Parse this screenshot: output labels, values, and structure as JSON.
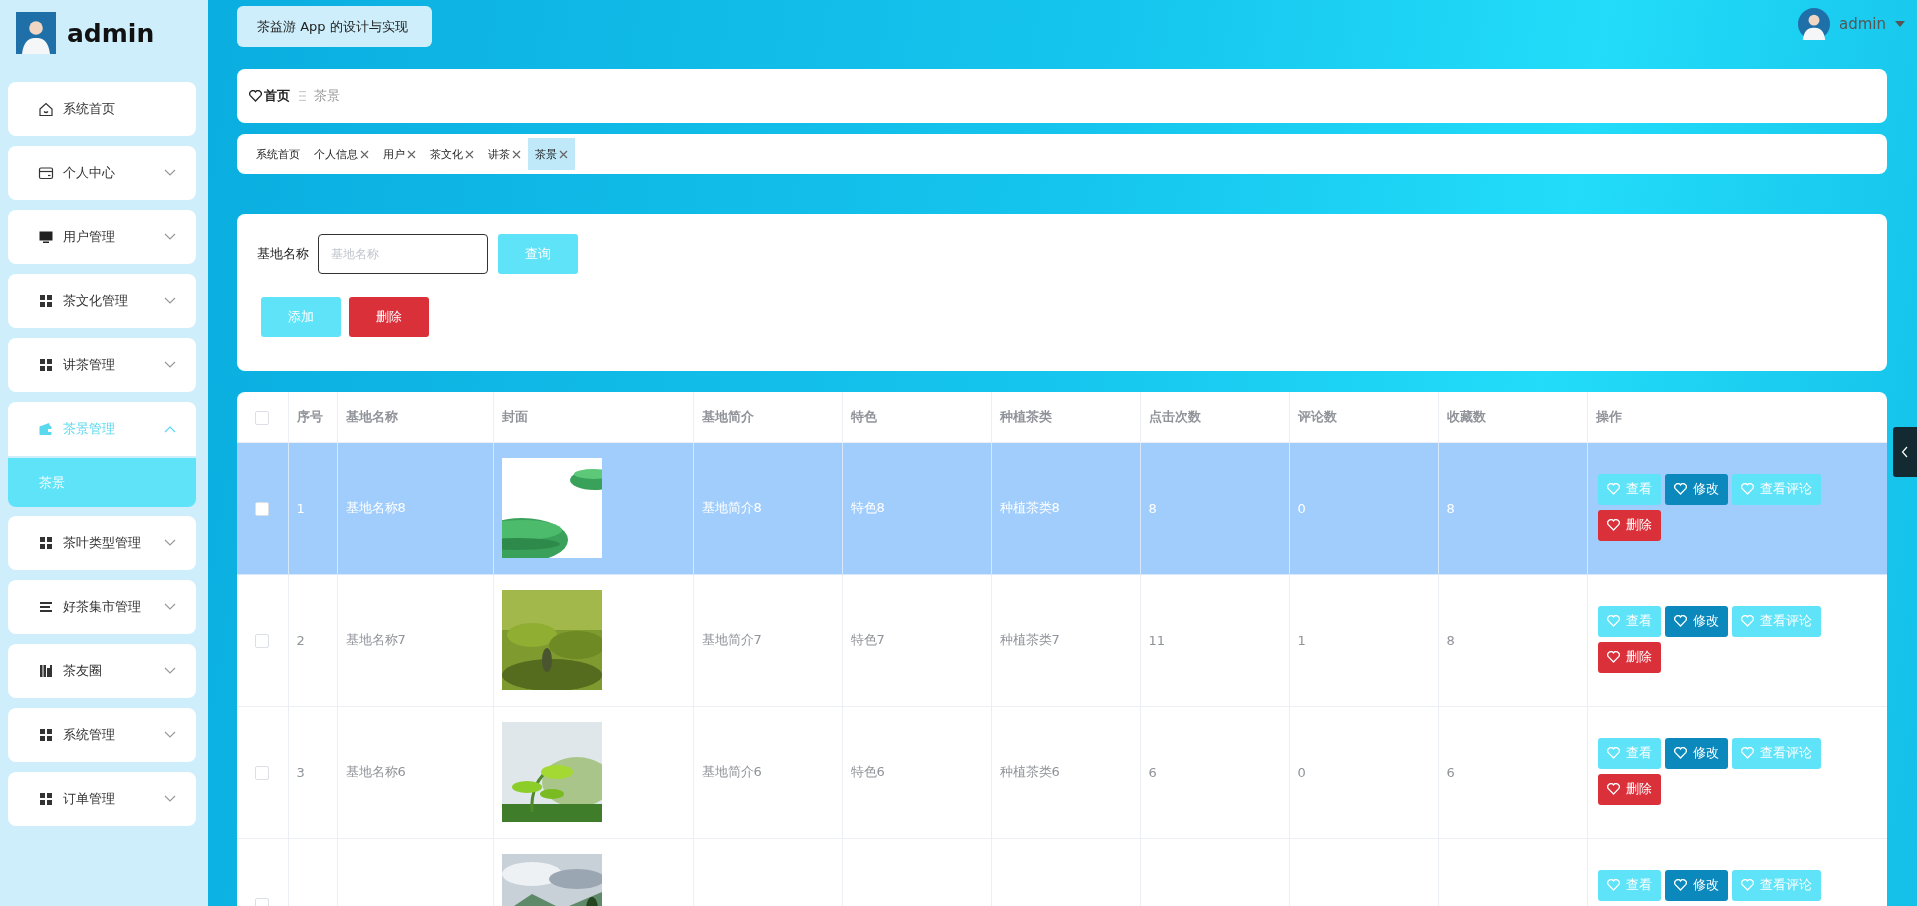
{
  "app_title": "茶益游 App 的设计与实现",
  "sidebar": {
    "user_name": "admin",
    "items": [
      {
        "label": "系统首页",
        "kind": "link",
        "selected": false
      },
      {
        "label": "个人中心",
        "kind": "group",
        "expanded": false,
        "selected": false
      },
      {
        "label": "用户管理",
        "kind": "group",
        "expanded": false,
        "selected": false
      },
      {
        "label": "茶文化管理",
        "kind": "group",
        "expanded": false,
        "selected": false
      },
      {
        "label": "讲茶管理",
        "kind": "group",
        "expanded": false,
        "selected": false
      },
      {
        "label": "茶景管理",
        "kind": "group",
        "expanded": true,
        "selected": true,
        "children": [
          {
            "label": "茶景",
            "selected": true
          }
        ]
      },
      {
        "label": "茶叶类型管理",
        "kind": "group",
        "expanded": false,
        "selected": false
      },
      {
        "label": "好茶集市管理",
        "kind": "group",
        "expanded": false,
        "selected": false
      },
      {
        "label": "茶友圈",
        "kind": "group",
        "expanded": false,
        "selected": false
      },
      {
        "label": "系统管理",
        "kind": "group",
        "expanded": false,
        "selected": false
      },
      {
        "label": "订单管理",
        "kind": "group",
        "expanded": false,
        "selected": false
      }
    ]
  },
  "user_menu": {
    "name": "admin"
  },
  "breadcrumb": [
    {
      "label": "首页"
    },
    {
      "label": "茶景"
    }
  ],
  "tabs": [
    {
      "label": "系统首页",
      "closable": false,
      "selected": false
    },
    {
      "label": "个人信息",
      "closable": true,
      "selected": false
    },
    {
      "label": "用户",
      "closable": true,
      "selected": false
    },
    {
      "label": "茶文化",
      "closable": true,
      "selected": false
    },
    {
      "label": "讲茶",
      "closable": true,
      "selected": false
    },
    {
      "label": "茶景",
      "closable": true,
      "selected": true
    }
  ],
  "search": {
    "label": "基地名称",
    "placeholder": "基地名称",
    "button": "查询"
  },
  "actions": [
    {
      "label": "添加",
      "kind": "add"
    },
    {
      "label": "删除",
      "kind": "delete"
    }
  ],
  "table": {
    "columns": [
      {
        "label": "序号",
        "kind": "text"
      },
      {
        "label": "基地名称",
        "kind": "text"
      },
      {
        "label": "封面"
      },
      {
        "label": "基地简介",
        "kind": "text"
      },
      {
        "label": "特色",
        "kind": "text"
      },
      {
        "label": "种植茶类",
        "kind": "text"
      },
      {
        "label": "点击次数",
        "kind": "text"
      },
      {
        "label": "评论数",
        "kind": "text"
      },
      {
        "label": "收藏数",
        "kind": "text"
      },
      {
        "label": "操作",
        "kind": "actions"
      }
    ],
    "select_all": {
      "checked": false
    },
    "rows": [
      {
        "selected": true,
        "checked": false,
        "values": [
          "1",
          "基地名称8",
          "基地简介8",
          "特色8",
          "种植茶类8",
          "8",
          "0",
          "8"
        ],
        "actions": [
          {
            "label": "查看",
            "kind": "view"
          },
          {
            "label": "修改",
            "kind": "edit"
          },
          {
            "label": "查看评论",
            "kind": "comments"
          },
          {
            "label": "删除",
            "kind": "delete"
          }
        ]
      },
      {
        "selected": false,
        "checked": false,
        "values": [
          "2",
          "基地名称7",
          "基地简介7",
          "特色7",
          "种植茶类7",
          "11",
          "1",
          "8"
        ],
        "actions": [
          {
            "label": "查看",
            "kind": "view"
          },
          {
            "label": "修改",
            "kind": "edit"
          },
          {
            "label": "查看评论",
            "kind": "comments"
          },
          {
            "label": "删除",
            "kind": "delete"
          }
        ]
      },
      {
        "selected": false,
        "checked": false,
        "values": [
          "3",
          "基地名称6",
          "基地简介6",
          "特色6",
          "种植茶类6",
          "6",
          "0",
          "6"
        ],
        "actions": [
          {
            "label": "查看",
            "kind": "view"
          },
          {
            "label": "修改",
            "kind": "edit"
          },
          {
            "label": "查看评论",
            "kind": "comments"
          },
          {
            "label": "删除",
            "kind": "delete"
          }
        ]
      },
      {
        "selected": false,
        "checked": false,
        "actions": [
          {
            "label": "查看",
            "kind": "view"
          },
          {
            "label": "修改",
            "kind": "edit"
          },
          {
            "label": "查看评论",
            "kind": "comments"
          }
        ]
      }
    ]
  }
}
